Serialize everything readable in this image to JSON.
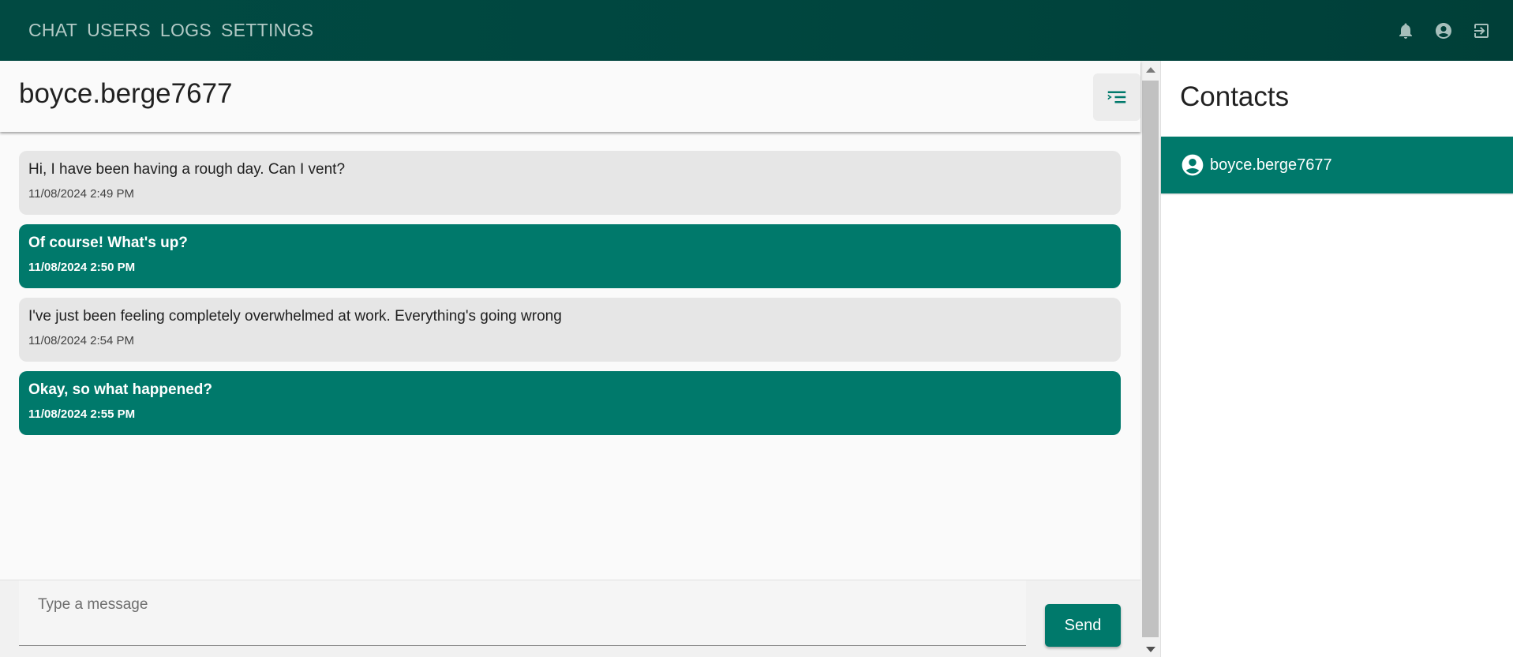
{
  "nav": {
    "links": [
      "CHAT",
      "USERS",
      "LOGS",
      "SETTINGS"
    ],
    "icons": [
      "bell-icon",
      "account-circle-icon",
      "logout-icon"
    ]
  },
  "chat": {
    "title": "boyce.berge7677",
    "toggle_icon": "menu-open-icon",
    "messages": [
      {
        "direction": "incoming",
        "text": "Hi, I have been having a rough day. Can I vent?",
        "time": "11/08/2024 2:49 PM"
      },
      {
        "direction": "outgoing",
        "text": "Of course! What's up?",
        "time": "11/08/2024 2:50 PM"
      },
      {
        "direction": "incoming",
        "text": "I've just been feeling completely overwhelmed at work. Everything's going wrong",
        "time": "11/08/2024 2:54 PM"
      },
      {
        "direction": "outgoing",
        "text": "Okay, so what happened?",
        "time": "11/08/2024 2:55 PM"
      }
    ],
    "composer": {
      "placeholder": "Type a message",
      "value": "",
      "send_label": "Send"
    }
  },
  "contacts": {
    "title": "Contacts",
    "items": [
      {
        "name": "boyce.berge7677",
        "icon": "account-circle-icon",
        "selected": true
      }
    ]
  },
  "colors": {
    "nav_bg": "#00463f",
    "accent": "#00796b",
    "incoming_bubble": "#e6e6e6",
    "page_bg": "#fafafa"
  }
}
